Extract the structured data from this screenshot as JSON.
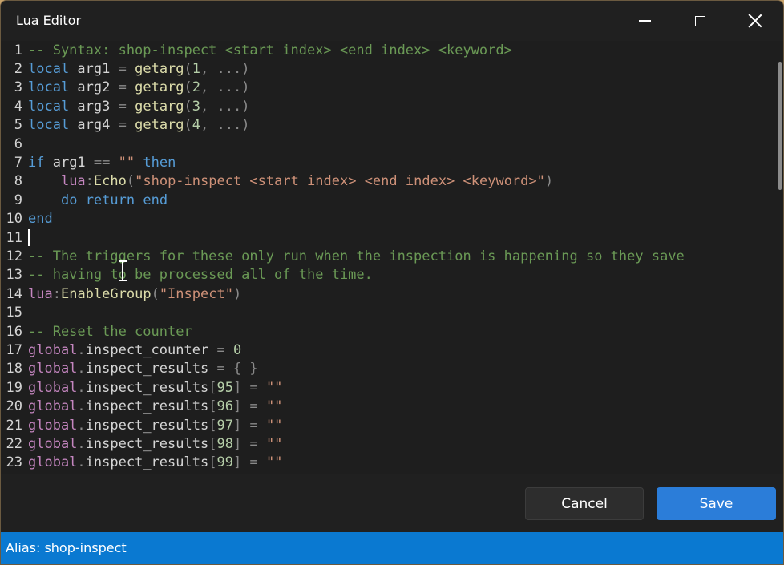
{
  "window": {
    "title": "Lua Editor",
    "controls": {
      "minimize_icon": "minimize-icon",
      "maximize_icon": "maximize-icon",
      "close_icon": "close-icon"
    }
  },
  "colors": {
    "comment": "#6a9955",
    "keyword": "#569cd6",
    "global": "#c586c0",
    "function": "#dcdcaa",
    "string": "#ce9178",
    "number": "#b5cea8",
    "accent": "#0a79d1",
    "save_button": "#2b7dd9"
  },
  "editor": {
    "line_numbers": [
      "1",
      "2",
      "3",
      "4",
      "5",
      "6",
      "7",
      "8",
      "9",
      "10",
      "11",
      "12",
      "13",
      "14",
      "15",
      "16",
      "17",
      "18",
      "19",
      "20",
      "21",
      "22",
      "23"
    ],
    "lines": [
      [
        {
          "t": "-- Syntax: shop-inspect <start index> <end index> <keyword>",
          "c": "comment"
        }
      ],
      [
        {
          "t": "local",
          "c": "kw"
        },
        {
          "t": " arg1 ",
          "c": "var"
        },
        {
          "t": "=",
          "c": "op"
        },
        {
          "t": " ",
          "c": "var"
        },
        {
          "t": "getarg",
          "c": "fn"
        },
        {
          "t": "(",
          "c": "punct"
        },
        {
          "t": "1",
          "c": "num"
        },
        {
          "t": ", ...)",
          "c": "punct"
        }
      ],
      [
        {
          "t": "local",
          "c": "kw"
        },
        {
          "t": " arg2 ",
          "c": "var"
        },
        {
          "t": "=",
          "c": "op"
        },
        {
          "t": " ",
          "c": "var"
        },
        {
          "t": "getarg",
          "c": "fn"
        },
        {
          "t": "(",
          "c": "punct"
        },
        {
          "t": "2",
          "c": "num"
        },
        {
          "t": ", ...)",
          "c": "punct"
        }
      ],
      [
        {
          "t": "local",
          "c": "kw"
        },
        {
          "t": " arg3 ",
          "c": "var"
        },
        {
          "t": "=",
          "c": "op"
        },
        {
          "t": " ",
          "c": "var"
        },
        {
          "t": "getarg",
          "c": "fn"
        },
        {
          "t": "(",
          "c": "punct"
        },
        {
          "t": "3",
          "c": "num"
        },
        {
          "t": ", ...)",
          "c": "punct"
        }
      ],
      [
        {
          "t": "local",
          "c": "kw"
        },
        {
          "t": " arg4 ",
          "c": "var"
        },
        {
          "t": "=",
          "c": "op"
        },
        {
          "t": " ",
          "c": "var"
        },
        {
          "t": "getarg",
          "c": "fn"
        },
        {
          "t": "(",
          "c": "punct"
        },
        {
          "t": "4",
          "c": "num"
        },
        {
          "t": ", ...)",
          "c": "punct"
        }
      ],
      [],
      [
        {
          "t": "if",
          "c": "kw"
        },
        {
          "t": " arg1 ",
          "c": "var"
        },
        {
          "t": "==",
          "c": "op"
        },
        {
          "t": " ",
          "c": "var"
        },
        {
          "t": "\"\"",
          "c": "str"
        },
        {
          "t": " ",
          "c": "var"
        },
        {
          "t": "then",
          "c": "kw"
        }
      ],
      [
        {
          "t": "    ",
          "c": "var"
        },
        {
          "t": "lua",
          "c": "global"
        },
        {
          "t": ":",
          "c": "punct"
        },
        {
          "t": "Echo",
          "c": "fn"
        },
        {
          "t": "(",
          "c": "punct"
        },
        {
          "t": "\"shop-inspect <start index> <end index> <keyword>\"",
          "c": "str"
        },
        {
          "t": ")",
          "c": "punct"
        }
      ],
      [
        {
          "t": "    ",
          "c": "var"
        },
        {
          "t": "do",
          "c": "kw"
        },
        {
          "t": " ",
          "c": "var"
        },
        {
          "t": "return",
          "c": "kw"
        },
        {
          "t": " ",
          "c": "var"
        },
        {
          "t": "end",
          "c": "kw"
        }
      ],
      [
        {
          "t": "end",
          "c": "kw"
        }
      ],
      [],
      [
        {
          "t": "-- The triggers for these only run when the inspection is happening so they save",
          "c": "comment"
        }
      ],
      [
        {
          "t": "-- having to be processed all of the time.",
          "c": "comment"
        }
      ],
      [
        {
          "t": "lua",
          "c": "global"
        },
        {
          "t": ":",
          "c": "punct"
        },
        {
          "t": "EnableGroup",
          "c": "fn"
        },
        {
          "t": "(",
          "c": "punct"
        },
        {
          "t": "\"Inspect\"",
          "c": "str"
        },
        {
          "t": ")",
          "c": "punct"
        }
      ],
      [],
      [
        {
          "t": "-- Reset the counter",
          "c": "comment"
        }
      ],
      [
        {
          "t": "global",
          "c": "global"
        },
        {
          "t": ".",
          "c": "punct"
        },
        {
          "t": "inspect_counter ",
          "c": "var"
        },
        {
          "t": "=",
          "c": "op"
        },
        {
          "t": " ",
          "c": "var"
        },
        {
          "t": "0",
          "c": "num"
        }
      ],
      [
        {
          "t": "global",
          "c": "global"
        },
        {
          "t": ".",
          "c": "punct"
        },
        {
          "t": "inspect_results ",
          "c": "var"
        },
        {
          "t": "=",
          "c": "op"
        },
        {
          "t": " { }",
          "c": "punct"
        }
      ],
      [
        {
          "t": "global",
          "c": "global"
        },
        {
          "t": ".",
          "c": "punct"
        },
        {
          "t": "inspect_results",
          "c": "var"
        },
        {
          "t": "[",
          "c": "punct"
        },
        {
          "t": "95",
          "c": "num"
        },
        {
          "t": "]",
          "c": "punct"
        },
        {
          "t": " ",
          "c": "var"
        },
        {
          "t": "=",
          "c": "op"
        },
        {
          "t": " ",
          "c": "var"
        },
        {
          "t": "\"\"",
          "c": "str"
        }
      ],
      [
        {
          "t": "global",
          "c": "global"
        },
        {
          "t": ".",
          "c": "punct"
        },
        {
          "t": "inspect_results",
          "c": "var"
        },
        {
          "t": "[",
          "c": "punct"
        },
        {
          "t": "96",
          "c": "num"
        },
        {
          "t": "]",
          "c": "punct"
        },
        {
          "t": " ",
          "c": "var"
        },
        {
          "t": "=",
          "c": "op"
        },
        {
          "t": " ",
          "c": "var"
        },
        {
          "t": "\"\"",
          "c": "str"
        }
      ],
      [
        {
          "t": "global",
          "c": "global"
        },
        {
          "t": ".",
          "c": "punct"
        },
        {
          "t": "inspect_results",
          "c": "var"
        },
        {
          "t": "[",
          "c": "punct"
        },
        {
          "t": "97",
          "c": "num"
        },
        {
          "t": "]",
          "c": "punct"
        },
        {
          "t": " ",
          "c": "var"
        },
        {
          "t": "=",
          "c": "op"
        },
        {
          "t": " ",
          "c": "var"
        },
        {
          "t": "\"\"",
          "c": "str"
        }
      ],
      [
        {
          "t": "global",
          "c": "global"
        },
        {
          "t": ".",
          "c": "punct"
        },
        {
          "t": "inspect_results",
          "c": "var"
        },
        {
          "t": "[",
          "c": "punct"
        },
        {
          "t": "98",
          "c": "num"
        },
        {
          "t": "]",
          "c": "punct"
        },
        {
          "t": " ",
          "c": "var"
        },
        {
          "t": "=",
          "c": "op"
        },
        {
          "t": " ",
          "c": "var"
        },
        {
          "t": "\"\"",
          "c": "str"
        }
      ],
      [
        {
          "t": "global",
          "c": "global"
        },
        {
          "t": ".",
          "c": "punct"
        },
        {
          "t": "inspect_results",
          "c": "var"
        },
        {
          "t": "[",
          "c": "punct"
        },
        {
          "t": "99",
          "c": "num"
        },
        {
          "t": "]",
          "c": "punct"
        },
        {
          "t": " ",
          "c": "var"
        },
        {
          "t": "=",
          "c": "op"
        },
        {
          "t": " ",
          "c": "var"
        },
        {
          "t": "\"\"",
          "c": "str"
        }
      ]
    ]
  },
  "footer": {
    "cancel_label": "Cancel",
    "save_label": "Save"
  },
  "status": {
    "text": "Alias: shop-inspect"
  }
}
